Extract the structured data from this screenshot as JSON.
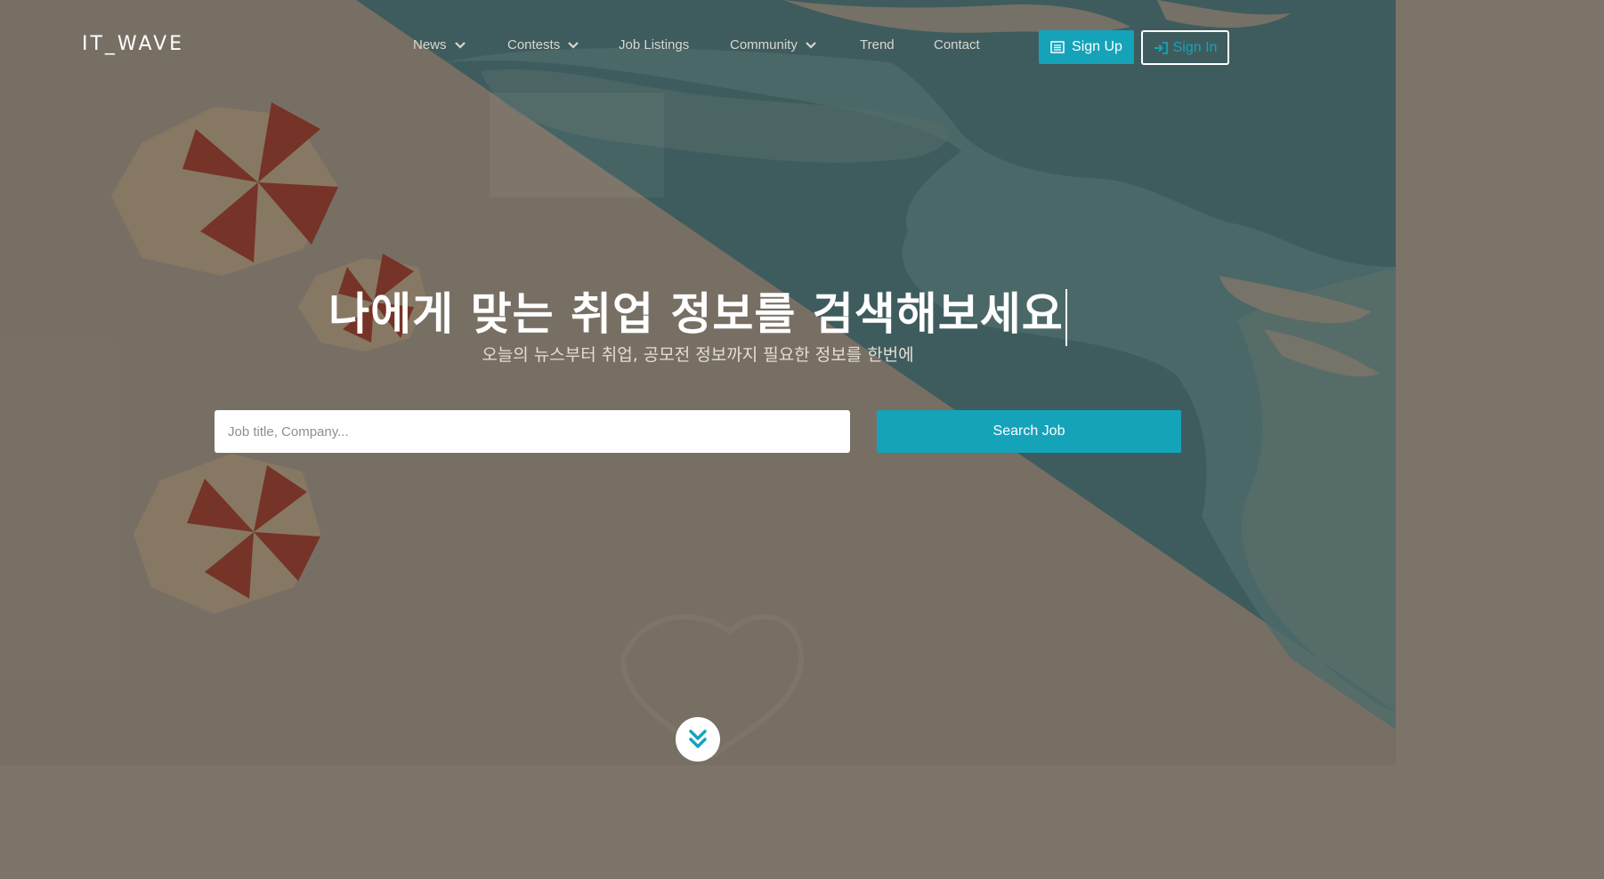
{
  "brand": {
    "logo_text": "IT_WAVE"
  },
  "nav": {
    "items": [
      {
        "label": "News",
        "has_dropdown": true
      },
      {
        "label": "Contests",
        "has_dropdown": true
      },
      {
        "label": "Job Listings",
        "has_dropdown": false
      },
      {
        "label": "Community",
        "has_dropdown": true
      },
      {
        "label": "Trend",
        "has_dropdown": false
      },
      {
        "label": "Contact",
        "has_dropdown": false
      }
    ],
    "signup_label": "Sign Up",
    "signin_label": "Sign In",
    "signup_icon": "list-icon",
    "signin_icon": "sign-in-icon"
  },
  "hero": {
    "title": "나에게 맞는 취업 정보를 검색해보세요",
    "subtitle": "오늘의 뉴스부터 취업, 공모전 정보까지 필요한 정보를 한번에"
  },
  "search": {
    "placeholder": "Job title, Company...",
    "value": "",
    "button_label": "Search Job"
  },
  "scroll": {
    "icon": "double-chevron-down-icon"
  },
  "colors": {
    "accent": "#15a3ba",
    "sand": "#7d7469",
    "sea": "#3d5a5c",
    "umbrella_red": "#7a3326"
  }
}
